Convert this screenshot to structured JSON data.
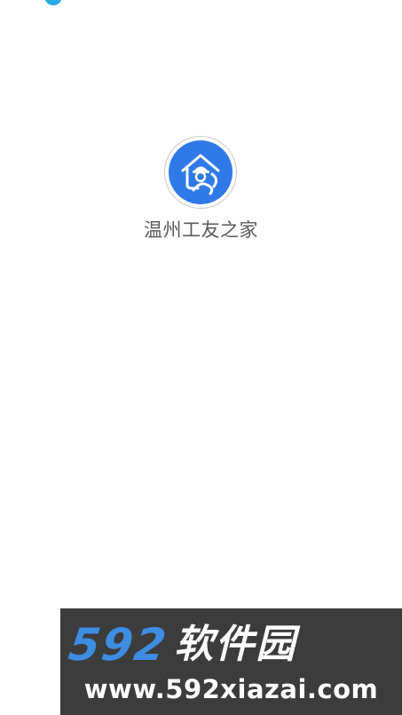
{
  "app": {
    "name": "温州工友之家",
    "icon": "house-worker-icon",
    "icon_color": "#2f79e9"
  },
  "status_bar": {
    "indicator_icon": "status-indicator-icon",
    "indicator_color": "#27a9e6"
  },
  "watermark": {
    "brand_digits": "592",
    "brand_text": "软件园",
    "url": "www.592xiazai.com",
    "digits_color": "#3d8de3",
    "background": "#3c3c3c"
  }
}
